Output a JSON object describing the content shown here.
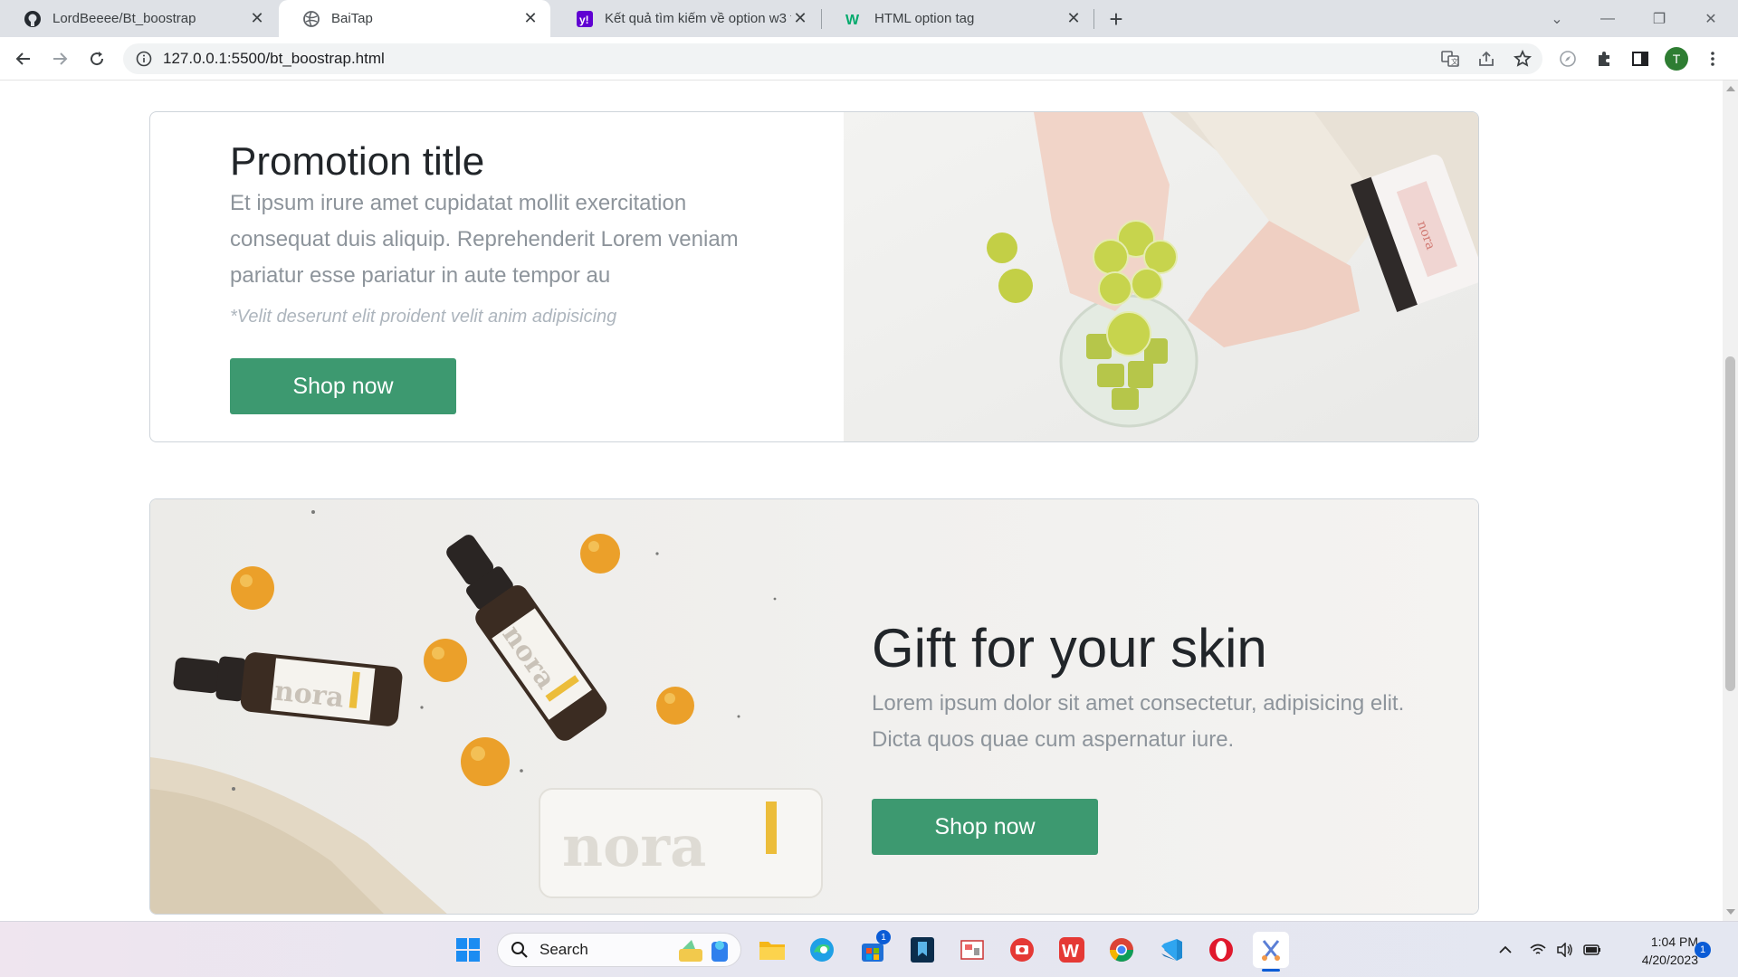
{
  "browser": {
    "tabs": [
      {
        "title": "LordBeeee/Bt_boostrap",
        "icon": "github-icon"
      },
      {
        "title": "BaiTap",
        "icon": "globe-icon"
      },
      {
        "title": "Kết quả tìm kiếm về option w3 tr",
        "icon": "yahoo-icon"
      },
      {
        "title": "HTML option tag",
        "icon": "w3schools-icon"
      }
    ],
    "address": "127.0.0.1:5500/bt_boostrap.html",
    "profile_initial": "T"
  },
  "promo": {
    "title": "Promotion title",
    "description": "Et ipsum irure amet cupidatat mollit exercitation consequat duis aliquip. Reprehenderit Lorem veniam pariatur esse pariatur in aute tempor au",
    "note": "*Velit deserunt elit proident velit anim adipisicing",
    "button": "Shop now"
  },
  "gift": {
    "title": "Gift for your skin",
    "description": "Lorem ipsum dolor sit amet consectetur, adipisicing elit. Dicta quos quae cum aspernatur iure.",
    "button": "Shop now"
  },
  "product_labels": {
    "brand": "nora"
  },
  "taskbar": {
    "search_placeholder": "Search",
    "store_badge": "1",
    "time": "1:04 PM",
    "date": "4/20/2023",
    "notification_count": "1"
  },
  "colors": {
    "button": "#3d9970",
    "title": "#212529",
    "muted": "#8d949b"
  }
}
